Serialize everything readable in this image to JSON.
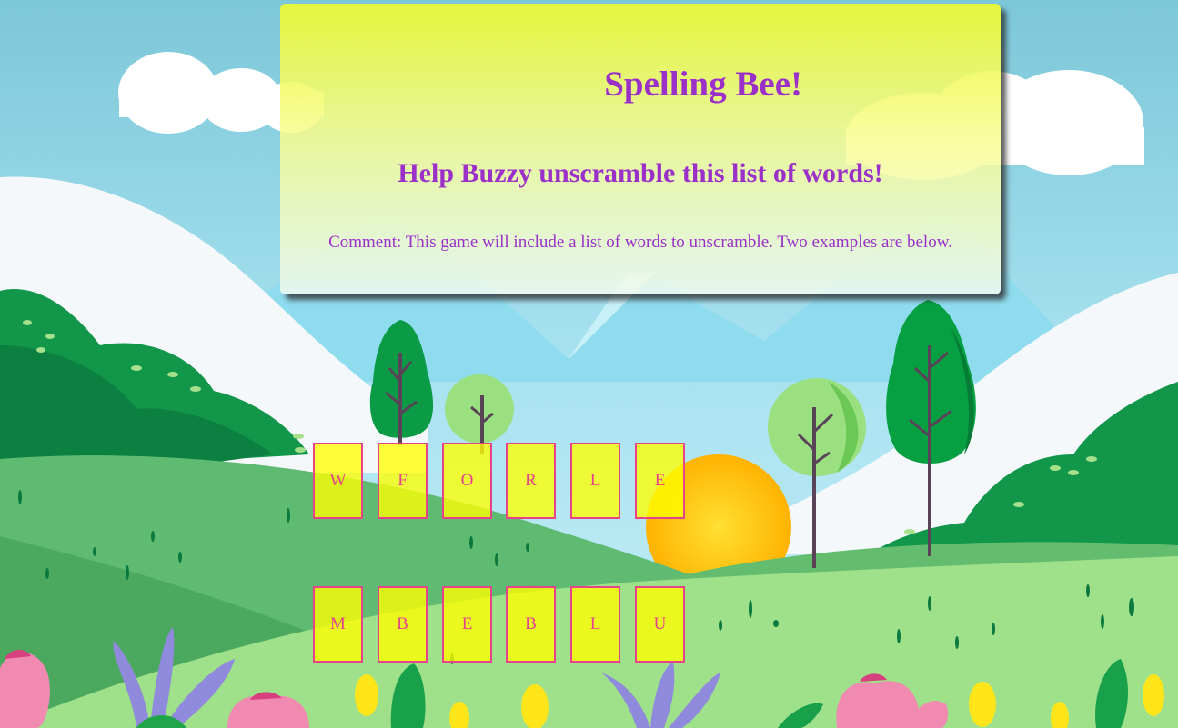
{
  "header": {
    "title": "Spelling Bee!",
    "subtitle": "Help Buzzy unscramble this list of words!",
    "comment": "Comment: This game will include a list of words to unscramble. Two examples are below."
  },
  "words": [
    {
      "letters": [
        "W",
        "F",
        "O",
        "R",
        "L",
        "E"
      ]
    },
    {
      "letters": [
        "M",
        "B",
        "E",
        "B",
        "L",
        "U"
      ]
    }
  ],
  "colors": {
    "text_purple": "#9b30c9",
    "tile_border": "#e6438a",
    "tile_fill": "#ffff00",
    "panel_yellow": "#eaf834"
  }
}
